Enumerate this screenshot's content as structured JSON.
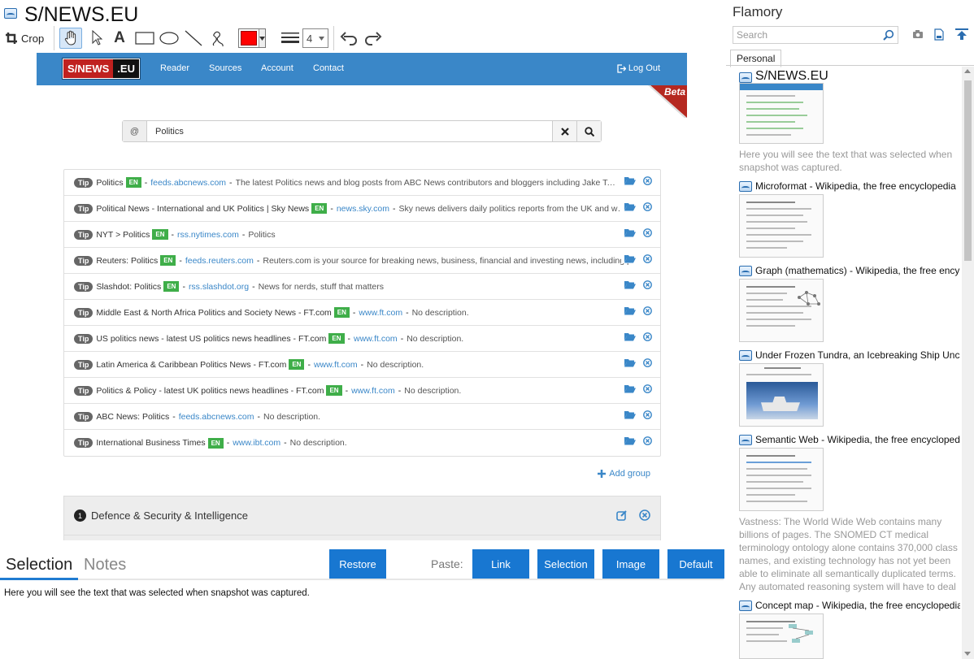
{
  "window": {
    "title": "S/NEWS.EU"
  },
  "toolbar": {
    "crop_label": "Crop",
    "line_width": "4",
    "color": "#ff0000"
  },
  "webpage": {
    "logo_left": "S/NEWS",
    "logo_right": ".EU",
    "nav": [
      "Reader",
      "Sources",
      "Account",
      "Contact"
    ],
    "logout": "Log Out",
    "beta": "Beta",
    "search": {
      "prefix": "@",
      "query": "Politics"
    },
    "feeds": [
      {
        "tip": "Tip",
        "title": "Politics",
        "lang": "EN",
        "url": "feeds.abcnews.com",
        "desc": "The latest Politics news and blog posts from ABC News contributors and bloggers including Jake Tapper, Ge…"
      },
      {
        "tip": "Tip",
        "title": "Political News - International and UK Politics | Sky News",
        "lang": "EN",
        "url": "news.sky.com",
        "desc": "Sky news delivers daily politics reports from the UK and w…"
      },
      {
        "tip": "Tip",
        "title": "NYT > Politics",
        "lang": "EN",
        "url": "rss.nytimes.com",
        "desc": "Politics"
      },
      {
        "tip": "Tip",
        "title": "Reuters: Politics",
        "lang": "EN",
        "url": "feeds.reuters.com",
        "desc": "Reuters.com is your source for breaking news, business, financial and investing news, including pers…"
      },
      {
        "tip": "Tip",
        "title": "Slashdot: Politics",
        "lang": "EN",
        "url": "rss.slashdot.org",
        "desc": "News for nerds, stuff that matters"
      },
      {
        "tip": "Tip",
        "title": "Middle East & North Africa Politics and Society News - FT.com",
        "lang": "EN",
        "url": "www.ft.com",
        "desc": "No description."
      },
      {
        "tip": "Tip",
        "title": "US politics news - latest US politics news headlines - FT.com",
        "lang": "EN",
        "url": "www.ft.com",
        "desc": "No description."
      },
      {
        "tip": "Tip",
        "title": "Latin America & Caribbean Politics News - FT.com",
        "lang": "EN",
        "url": "www.ft.com",
        "desc": "No description."
      },
      {
        "tip": "Tip",
        "title": "Politics & Policy - latest UK politics news headlines - FT.com",
        "lang": "EN",
        "url": "www.ft.com",
        "desc": "No description."
      },
      {
        "tip": "Tip",
        "title": "ABC News: Politics",
        "lang": "",
        "url": "feeds.abcnews.com",
        "desc": "No description."
      },
      {
        "tip": "Tip",
        "title": "International Business Times",
        "lang": "EN",
        "url": "www.ibt.com",
        "desc": "No description."
      }
    ],
    "add_group": "Add group",
    "group": {
      "number": "1",
      "name": "Defence & Security & Intelligence"
    }
  },
  "bottom": {
    "tabs": {
      "selection": "Selection",
      "notes": "Notes"
    },
    "restore": "Restore",
    "paste_label": "Paste:",
    "paste_buttons": [
      "Link",
      "Selection",
      "Image",
      "Default"
    ],
    "selection_text": "Here you will see the text that was selected when snapshot was captured."
  },
  "right": {
    "app_name": "Flamory",
    "search_placeholder": "Search",
    "tab": "Personal",
    "items": [
      {
        "title": "S/NEWS.EU",
        "desc": "Here you will see the text that was selected when snapshot was captured."
      },
      {
        "title": "Microformat - Wikipedia, the free encyclopedia",
        "desc": ""
      },
      {
        "title": "Graph (mathematics) - Wikipedia, the free ency",
        "desc": ""
      },
      {
        "title": "Under Frozen Tundra, an Icebreaking Ship Unco",
        "desc": ""
      },
      {
        "title": "Semantic Web - Wikipedia, the free encycloped",
        "desc": "Vastness: The World Wide Web contains many billions of pages. The SNOMED CT medical terminology ontology alone contains 370,000 class names, and existing technology has not yet been able to eliminate all semantically duplicated terms. Any automated reasoning system will have to deal with truly huge inputs."
      },
      {
        "title": "Concept map - Wikipedia, the free encyclopedia",
        "desc": ""
      }
    ]
  },
  "colors": {
    "accent": "#1877d1",
    "nav": "#3a87c8",
    "lang_badge": "#3fae49"
  }
}
